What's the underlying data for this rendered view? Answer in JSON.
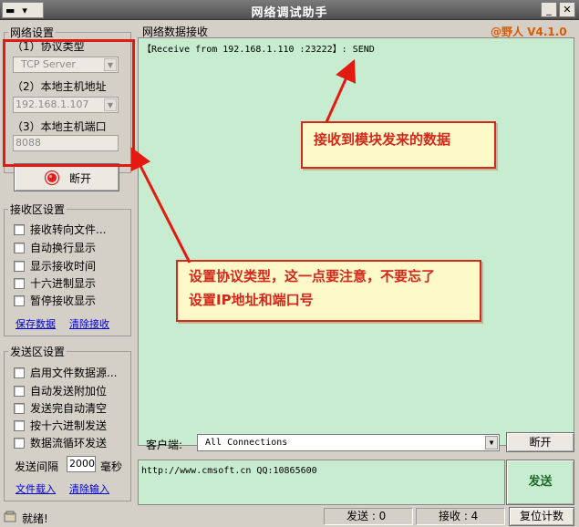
{
  "window": {
    "title": "网络调试助手",
    "sysmenu_label": "▬",
    "sysmenu_arrow": "▾",
    "minimize": "_",
    "close": "✕",
    "version_badge": "@野人 V4.1.0"
  },
  "network": {
    "group_title": "网络设置",
    "protocol_label": "（1）协议类型",
    "protocol_value": "TCP Server",
    "host_label": "（2）本地主机地址",
    "host_value": "192.168.1.107",
    "port_label": "（3）本地主机端口",
    "port_value": "8088",
    "disconnect_button": "断开",
    "combo_arrow": "▼"
  },
  "receive_settings": {
    "group_title": "接收区设置",
    "options": [
      "接收转向文件...",
      "自动换行显示",
      "显示接收时间",
      "十六进制显示",
      "暂停接收显示"
    ],
    "save_link": "保存数据",
    "clear_link": "清除接收"
  },
  "send_settings": {
    "group_title": "发送区设置",
    "options": [
      "启用文件数据源...",
      "自动发送附加位",
      "发送完自动清空",
      "按十六进制发送",
      "数据流循环发送"
    ],
    "interval_label": "发送间隔",
    "interval_value": "2000",
    "interval_unit": "毫秒",
    "load_link": "文件载入",
    "clear_link": "清除输入"
  },
  "receive_area": {
    "title": "网络数据接收",
    "content": "【Receive from 192.168.1.110 :23222】: SEND"
  },
  "client_bar": {
    "label": "客户端:",
    "value": "All Connections",
    "disconnect_button": "断开"
  },
  "send_area": {
    "content": "http://www.cmsoft.cn QQ:10865600",
    "send_button": "发送"
  },
  "statusbar": {
    "ready": "就绪!",
    "sent": "发送 : 0",
    "received": "接收 : 4",
    "reset_button": "复位计数"
  },
  "annotations": {
    "callout_receive": "接收到模块发来的数据",
    "callout_settings": [
      "设置协议类型，这一点要注意，不要忘了",
      "设置IP地址和端口号"
    ]
  },
  "colors": {
    "annotation_red": "#e21a12",
    "text_area_green": "#c7ecd0",
    "version_orange": "#e05a00"
  }
}
